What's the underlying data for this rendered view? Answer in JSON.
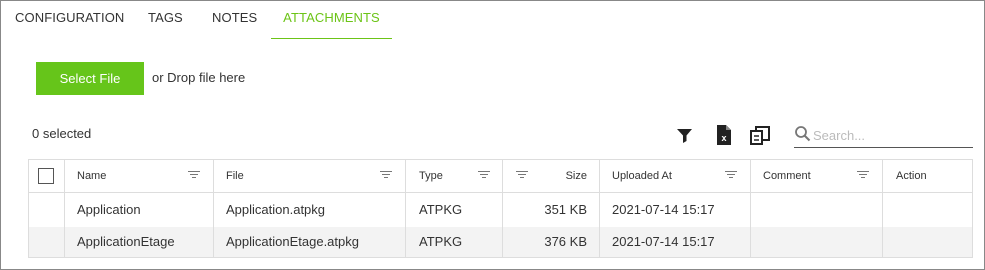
{
  "tabs": [
    {
      "label": "CONFIGURATION",
      "active": false
    },
    {
      "label": "TAGS",
      "active": false
    },
    {
      "label": "NOTES",
      "active": false
    },
    {
      "label": "ATTACHMENTS",
      "active": true
    }
  ],
  "upload": {
    "select_button_label": "Select File",
    "drop_text": "or Drop file here"
  },
  "toolbar": {
    "selected_count": "0 selected",
    "icons": [
      "filter-icon",
      "excel-export-icon",
      "column-chooser-icon",
      "search-icon"
    ],
    "search_placeholder": "Search...",
    "search_value": ""
  },
  "table": {
    "columns": [
      "Name",
      "File",
      "Type",
      "Size",
      "Uploaded At",
      "Comment",
      "Action"
    ],
    "rows": [
      {
        "name": "Application",
        "file": "Application.atpkg",
        "type": "ATPKG",
        "size": "351 KB",
        "uploaded_at": "2021-07-14 15:17",
        "comment": "",
        "action": ""
      },
      {
        "name": "ApplicationEtage",
        "file": "ApplicationEtage.atpkg",
        "type": "ATPKG",
        "size": "376 KB",
        "uploaded_at": "2021-07-14 15:17",
        "comment": "",
        "action": ""
      }
    ]
  },
  "colors": {
    "accent": "#66c51a",
    "active_tab": "#6cc417",
    "alt_row": "#f3f3f3",
    "border": "#dddddd"
  }
}
